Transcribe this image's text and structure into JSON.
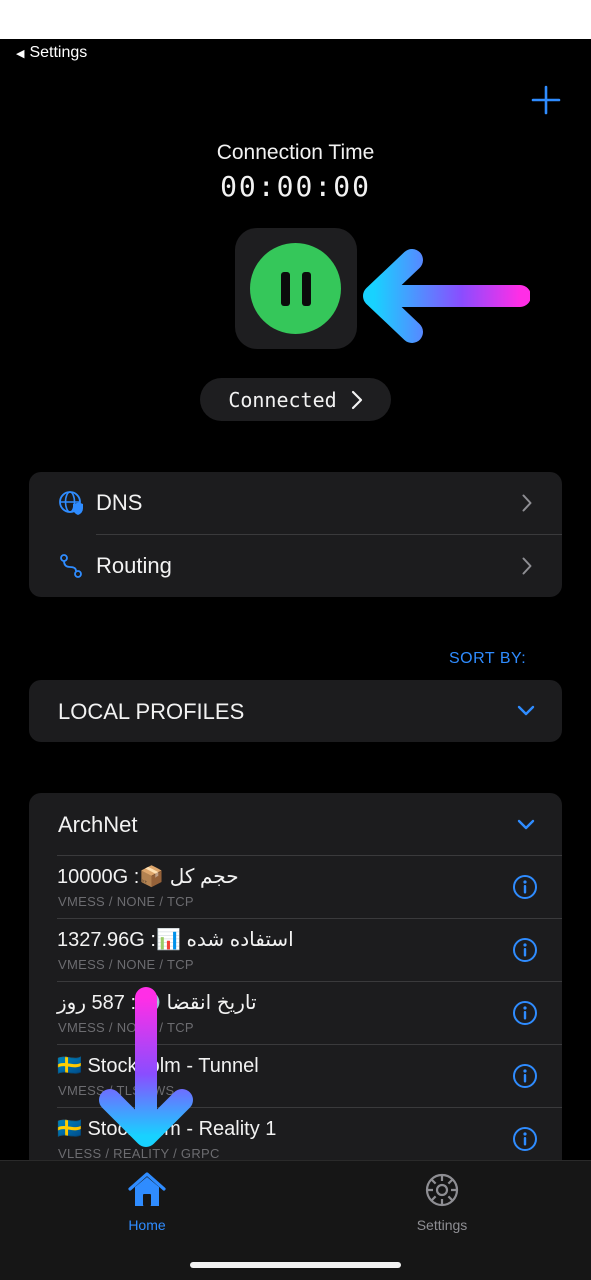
{
  "nav": {
    "back_label": "Settings"
  },
  "header": {
    "connection_label": "Connection Time",
    "timer": "00:00:00"
  },
  "status": {
    "label": "Connected"
  },
  "settings_rows": [
    {
      "label": "DNS"
    },
    {
      "label": "Routing"
    }
  ],
  "sort": {
    "label": "SORT BY:"
  },
  "local_profiles": {
    "title": "LOCAL PROFILES"
  },
  "group": {
    "title": "ArchNet",
    "items": [
      {
        "name": "10000G :📦 حجم کل",
        "sub": "VMESS / NONE / TCP"
      },
      {
        "name": "1327.96G :📊 استفاده شده",
        "sub": "VMESS / NONE / TCP"
      },
      {
        "name": "تاریخ انقضا 🕐: 587 روز",
        "sub": "VMESS / NONE / TCP"
      },
      {
        "name": "🇸🇪 Stockholm - Tunnel",
        "sub": "VMESS / TLS / WS"
      },
      {
        "name": "🇸🇪 Stockholm - Reality 1",
        "sub": "VLESS / REALITY / GRPC"
      }
    ]
  },
  "tabs": [
    {
      "label": "Home",
      "icon": "home-icon",
      "active": true
    },
    {
      "label": "Settings",
      "icon": "gear-icon",
      "active": false
    }
  ],
  "colors": {
    "accent": "#2f8cff",
    "connected_green": "#35c75a",
    "card": "#1c1c1e",
    "background": "#000000"
  }
}
